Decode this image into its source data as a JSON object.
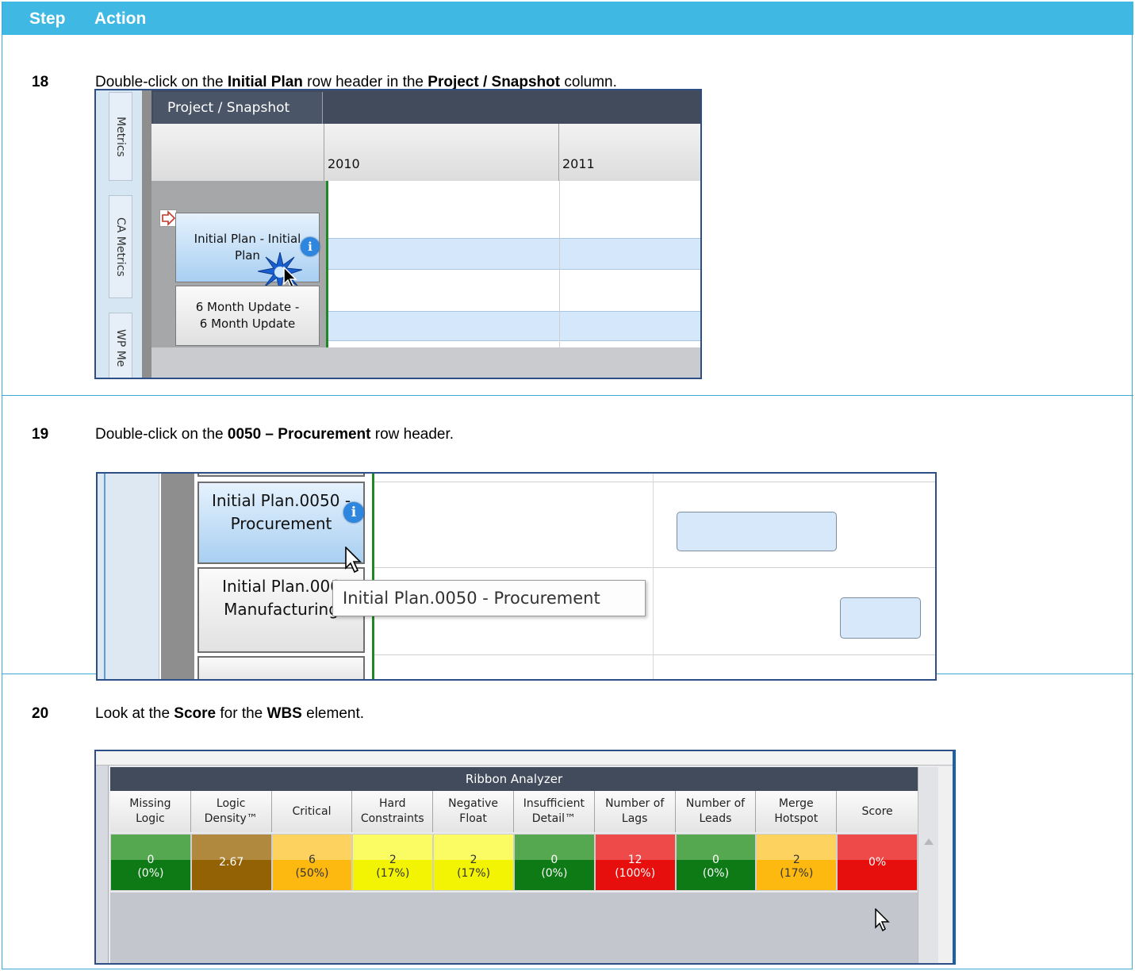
{
  "table": {
    "header_step": "Step",
    "header_action": "Action"
  },
  "steps": [
    {
      "number": "18",
      "pre": "Double-click on the ",
      "b1": "Initial Plan",
      "mid": " row header in the ",
      "b2": "Project / Snapshot",
      "post": " column."
    },
    {
      "number": "19",
      "pre": "Double-click on the ",
      "b1": "0050 – Procurement",
      "post": " row header."
    },
    {
      "number": "20",
      "pre": "Look at the ",
      "b1": "Score",
      "mid": " for the ",
      "b2": "WBS",
      "post": " element."
    }
  ],
  "shot1": {
    "tabs": [
      "Metrics",
      "CA Metrics",
      "WP Me"
    ],
    "column_title": "Project / Snapshot",
    "years": [
      "2010",
      "2011"
    ],
    "rows": [
      "Initial  Plan - Initial\nPlan",
      "6 Month Update -\n6 Month Update"
    ]
  },
  "shot2": {
    "rows": [
      "Initial  Plan.0050 -\nProcurement",
      "Initial  Plan.006\nManufacturing"
    ],
    "tooltip": "Initial  Plan.0050 - Procurement"
  },
  "shot3": {
    "title": "Ribbon Analyzer",
    "columns": [
      {
        "header": "Missing\nLogic",
        "value": "0\n(0%)",
        "hi": "#55a84f",
        "lo": "#0e7a16",
        "fg": "#ffffff"
      },
      {
        "header": "Logic\nDensity™",
        "value": "2.67",
        "hi": "#b0893e",
        "lo": "#936205",
        "fg": "#ffffff"
      },
      {
        "header": "Critical",
        "value": "6\n(50%)",
        "hi": "#fdd25f",
        "lo": "#fdb910",
        "fg": "#333333"
      },
      {
        "header": "Hard\nConstraints",
        "value": "2\n(17%)",
        "hi": "#fbfb63",
        "lo": "#f3f304",
        "fg": "#333333"
      },
      {
        "header": "Negative\nFloat",
        "value": "2\n(17%)",
        "hi": "#fbfb63",
        "lo": "#f3f304",
        "fg": "#333333"
      },
      {
        "header": "Insufficient\nDetail™",
        "value": "0\n(0%)",
        "hi": "#55a84f",
        "lo": "#0e7a16",
        "fg": "#ffffff"
      },
      {
        "header": "Number of\nLags",
        "value": "12\n(100%)",
        "hi": "#ef4a4a",
        "lo": "#e70e0e",
        "fg": "#ffffff"
      },
      {
        "header": "Number of\nLeads",
        "value": "0\n(0%)",
        "hi": "#55a84f",
        "lo": "#0e7a16",
        "fg": "#ffffff"
      },
      {
        "header": "Merge\nHotspot",
        "value": "2\n(17%)",
        "hi": "#fdd25f",
        "lo": "#fdb910",
        "fg": "#333333"
      },
      {
        "header": "Score",
        "value": "0%",
        "hi": "#ef4a4a",
        "lo": "#e70e0e",
        "fg": "#ffffff"
      }
    ]
  }
}
